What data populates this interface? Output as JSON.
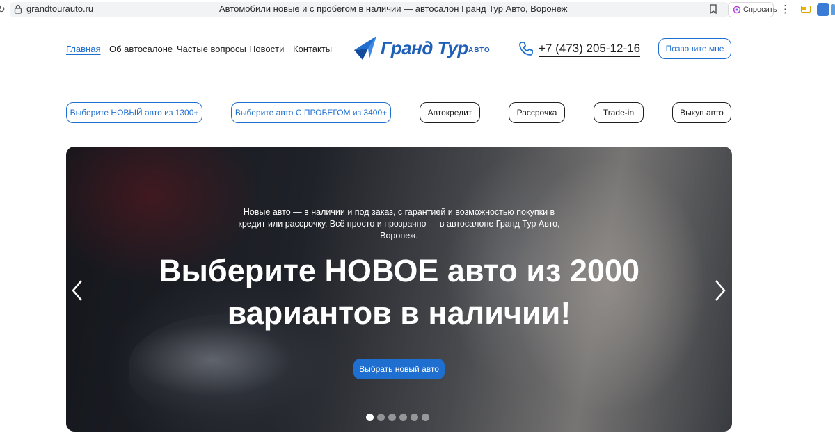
{
  "browser": {
    "url": "grandtourauto.ru",
    "tab_title": "Автомобили новые и с пробегом в наличии — автосалон Гранд Тур Авто, Воронеж",
    "ask_label": "Спросить"
  },
  "header": {
    "nav": [
      "Главная",
      "Об автосалоне",
      "Частые вопросы",
      "Новости",
      "Контакты"
    ],
    "active_nav": "Главная",
    "logo_text": "Гранд Тур",
    "logo_sub": "АВТО",
    "phone": "+7 (473) 205-12-16",
    "callback_label": "Позвоните мне",
    "brand_color": "#1f6fd1"
  },
  "categories": [
    "Выберите НОВЫЙ авто из 1300+",
    "Выберите авто С ПРОБЕГОМ из 3400+",
    "Автокредит",
    "Рассрочка",
    "Trade-in",
    "Выкуп авто"
  ],
  "hero": {
    "subtitle": "Новые авто — в наличии и под заказ, с гарантией и возможностью покупки в кредит или рассрочку. Всё просто и прозрачно — в автосалоне Гранд Тур Авто, Воронеж.",
    "title": "Выберите НОВОЕ авто из 2000 вариантов в наличии!",
    "cta_label": "Выбрать новый авто",
    "slide_count": 6,
    "active_slide": 1
  }
}
